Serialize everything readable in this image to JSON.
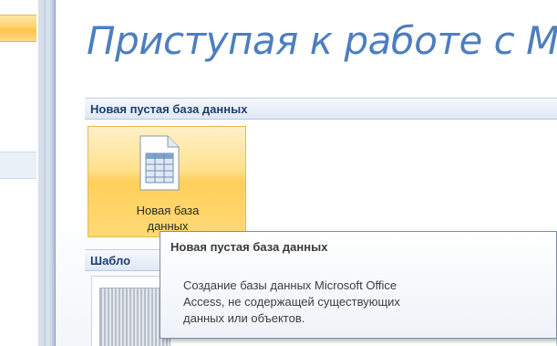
{
  "main": {
    "title": "Приступая к работе с M"
  },
  "blank_db": {
    "section_title": "Новая пустая база данных",
    "tile_label": "Новая база\nданных"
  },
  "templates": {
    "section_title": "Шабло"
  },
  "tooltip": {
    "title": "Новая пустая база данных",
    "body": "Создание базы данных Microsoft Office\nAccess, не содержащей существующих\nданных или объектов."
  },
  "icons": {
    "tile_icon": "blank-database-table-icon"
  },
  "colors": {
    "title": "#4d7fbf",
    "section_header_text": "#1e3e6e",
    "tile_highlight": "#ffd05a",
    "tooltip_border": "#7f8ea5"
  }
}
